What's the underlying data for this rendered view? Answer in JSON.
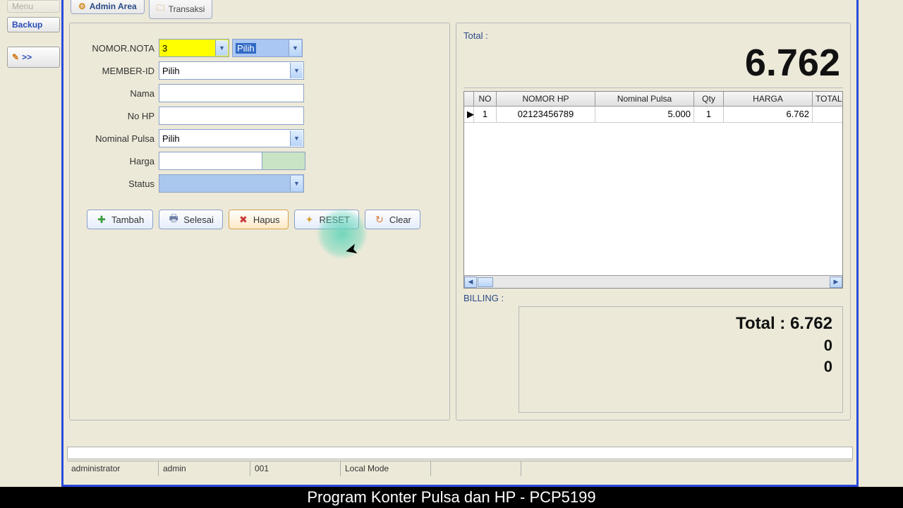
{
  "toolbar": {
    "menu": "Menu",
    "backup": "Backup",
    "arrow": ">>"
  },
  "tabs": {
    "admin": "Admin Area",
    "transaksi": "Transaksi"
  },
  "form": {
    "nomor_nota_label": "NOMOR.NOTA",
    "nomor_nota_value": "3",
    "nota_pilih": "Pilih",
    "member_label": "MEMBER-ID",
    "member_value": "Pilih",
    "nama_label": "Nama",
    "nama_value": "",
    "nohp_label": "No HP",
    "nohp_value": "",
    "nominal_label": "Nominal Pulsa",
    "nominal_value": "Pilih",
    "harga_label": "Harga",
    "harga_value": "",
    "status_label": "Status",
    "status_value": ""
  },
  "buttons": {
    "tambah": "Tambah",
    "selesai": "Selesai",
    "hapus": "Hapus",
    "reset": "RESET",
    "clear": "Clear"
  },
  "right": {
    "total_label": "Total :",
    "total_value": "6.762",
    "headers": {
      "no": "NO",
      "hp": "NOMOR HP",
      "nominal": "Nominal Pulsa",
      "qty": "Qty",
      "harga": "HARGA",
      "total": "TOTAL"
    },
    "rows": [
      {
        "no": "1",
        "hp": "02123456789",
        "nominal": "5.000",
        "qty": "1",
        "harga": "6.762"
      }
    ],
    "billing_label": "BILLING :",
    "billing_total": "Total : 6.762",
    "billing_z1": "0",
    "billing_z2": "0"
  },
  "status": {
    "user": "administrator",
    "role": "admin",
    "code": "001",
    "mode": "Local Mode"
  },
  "bottom": "Program Konter Pulsa dan HP - PCP5199"
}
